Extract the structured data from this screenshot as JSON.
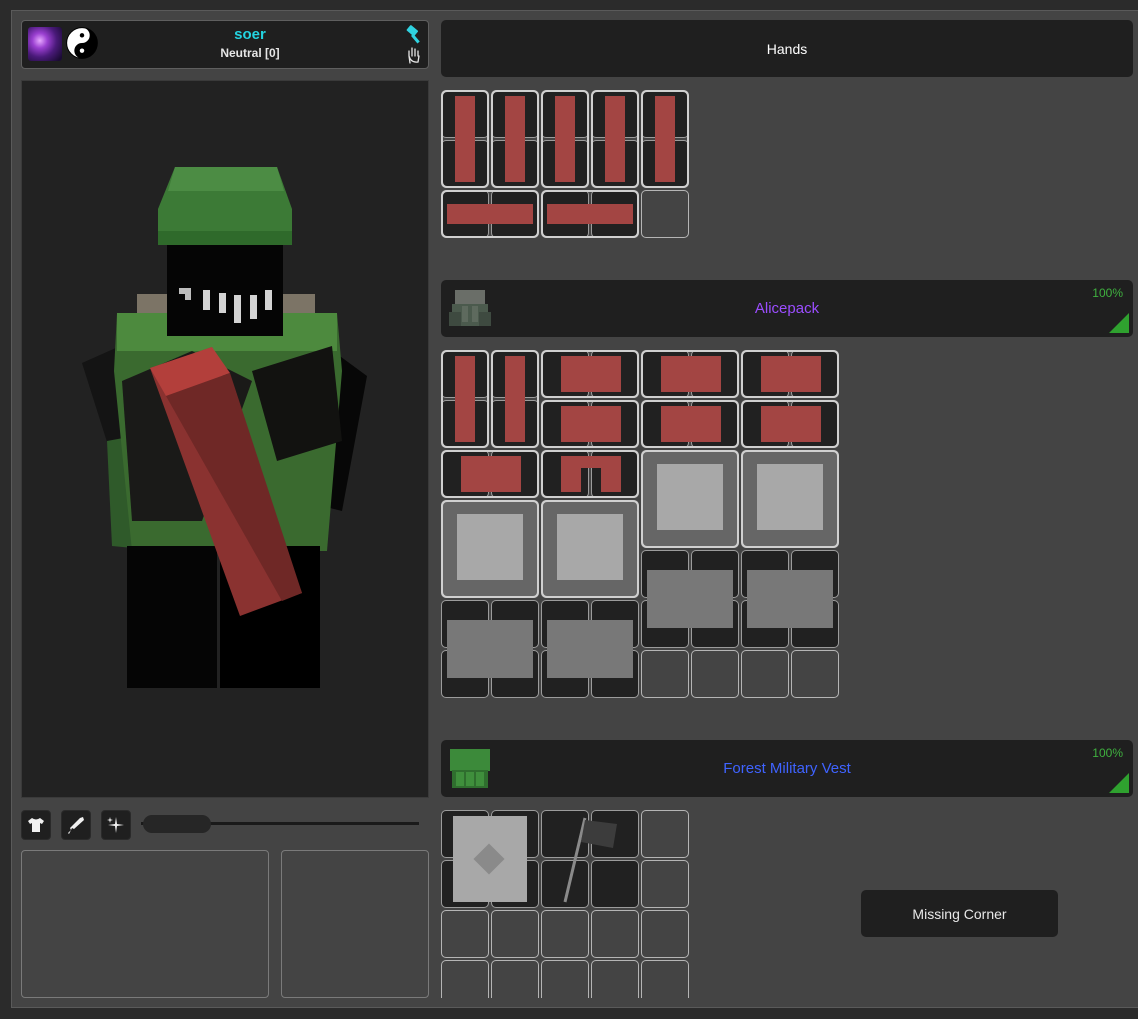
{
  "player": {
    "name": "soer",
    "reputation": "Neutral [0]"
  },
  "hands": {
    "title": "Hands"
  },
  "backpack": {
    "name": "Alicepack",
    "quality": "100%"
  },
  "vest": {
    "name": "Forest Military Vest",
    "quality": "100%"
  },
  "missing_corner": {
    "label": "Missing Corner"
  },
  "colors": {
    "player_name": "#23d3e0",
    "backpack_name": "#9b4dff",
    "vest_name": "#3f63ff",
    "quality": "#3fb03f",
    "magazine": "#a34543"
  },
  "icons": {
    "skill": "purple-skill-icon",
    "faction": "yin-yang-icon",
    "tool": "hammer-icon",
    "interact": "hand-icon",
    "toolbar": [
      "shirt-icon",
      "rifle-icon",
      "sparkle-icon"
    ]
  },
  "view_slider": {
    "value": 0.25
  }
}
